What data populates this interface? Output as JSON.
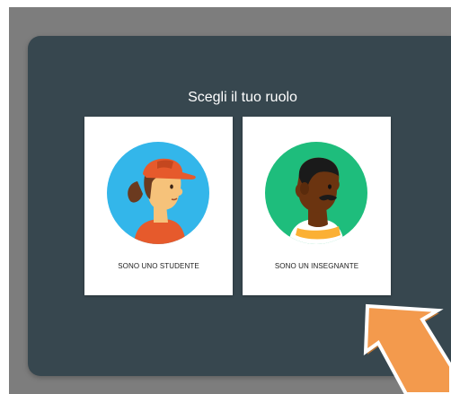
{
  "dialog": {
    "title": "Scegli il tuo ruolo"
  },
  "roles": [
    {
      "label": "SONO UNO STUDENTE",
      "avatar_bg": "#33b6ea"
    },
    {
      "label": "SONO UN INSEGNANTE",
      "avatar_bg": "#1ebd7c"
    }
  ],
  "colors": {
    "dialog_bg": "#37474f",
    "overlay": "#7d7d7d",
    "arrow": "#f39a4d"
  },
  "icons": [
    "student-avatar-icon",
    "teacher-avatar-icon",
    "pointer-arrow-icon"
  ]
}
